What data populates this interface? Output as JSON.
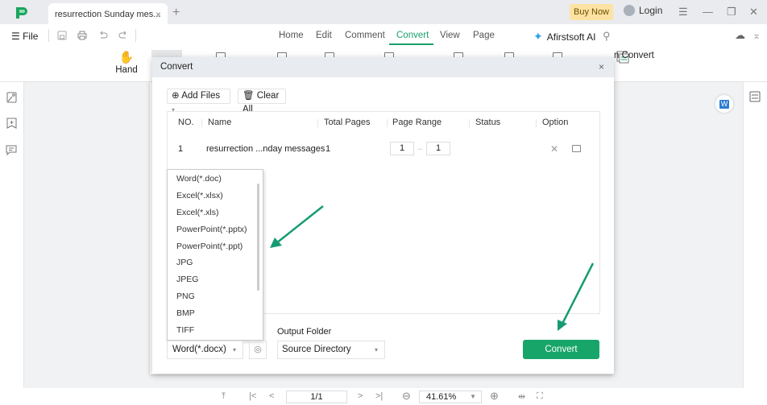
{
  "titlebar": {
    "tab_title": "resurrection Sunday mes...",
    "tab_close": "×",
    "new_tab": "+",
    "buy_now": "Buy Now",
    "login": "Login",
    "menu_icon": "☰",
    "minimize_icon": "—",
    "restore_icon": "❐",
    "close_icon": "✕"
  },
  "menubar": {
    "file": "☰ File",
    "quick_icons": [
      "save-icon",
      "print-icon",
      "undo-icon",
      "redo-icon"
    ],
    "tabs": [
      "Home",
      "Edit",
      "Comment",
      "Convert",
      "View",
      "Page"
    ],
    "active_tab": "Convert",
    "ai_label": "Afirstsoft AI",
    "search_icon": "⚲",
    "cloud_icon": "☁",
    "collapse_icon": "⌅"
  },
  "ribbon": {
    "hand_label": "Hand",
    "hand_icon": "✋",
    "partial_convert_label": "n Convert"
  },
  "dialog": {
    "title": "Convert",
    "close": "×",
    "add_files": "⊕ Add Files",
    "add_files_arrow": "▾",
    "clear_all": "🗑 Clear All",
    "columns": [
      "NO.",
      "Name",
      "Total Pages",
      "Page Range",
      "Status",
      "Option"
    ],
    "rows": [
      {
        "no": "1",
        "name": "resurrection ...nday messages",
        "total_pages": "1",
        "range_from": "1",
        "range_to": "1",
        "status": ""
      }
    ],
    "range_sep": "–",
    "row_delete": "✕",
    "format_options": [
      "Word(*.doc)",
      "Excel(*.xlsx)",
      "Excel(*.xls)",
      "PowerPoint(*.pptx)",
      "PowerPoint(*.ppt)",
      "JPG",
      "JPEG",
      "PNG",
      "BMP",
      "TIFF"
    ],
    "format_selected": "Word(*.docx)",
    "dropdown_arrow": "▾",
    "settings_icon": "◎",
    "output_folder_label": "Output Folder",
    "output_folder_value": "Source Directory",
    "convert_button": "Convert"
  },
  "statusbar": {
    "to_top": "⤒",
    "first": "|<",
    "prev": "<",
    "page": "1/1",
    "next": ">",
    "last": ">|",
    "zoom_out": "⊖",
    "zoom": "41.61%",
    "zoom_in": "⊕",
    "fit_width": "⇹",
    "fit_page": "⛶"
  },
  "colors": {
    "accent": "#18a569",
    "buy_now_bg": "#fde3a3",
    "annotation_arrow": "#169c74"
  }
}
